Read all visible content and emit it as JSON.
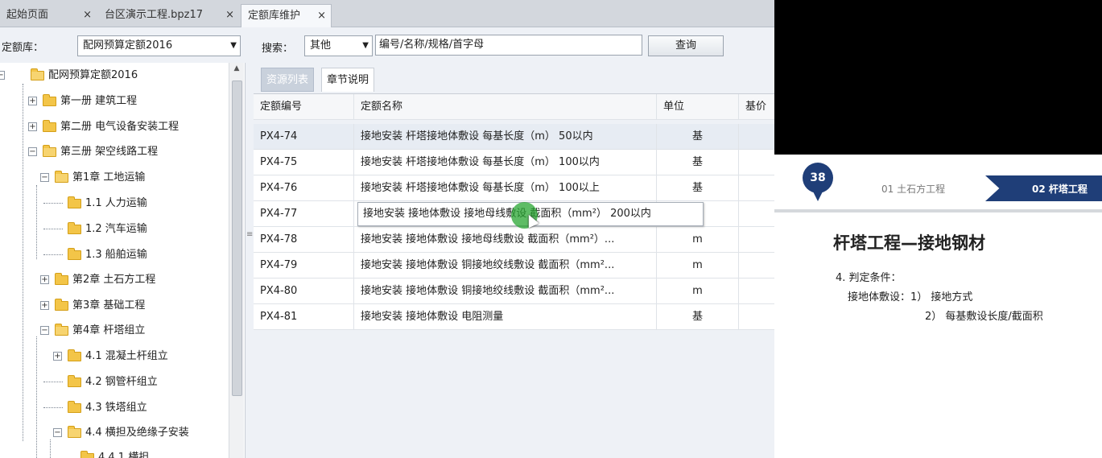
{
  "doc_tabs": [
    {
      "label": "起始页面",
      "close": "×"
    },
    {
      "label": "台区演示工程.bpz17",
      "close": "×"
    },
    {
      "label": "定额库维护",
      "close": "×"
    }
  ],
  "toolbar": {
    "library_label": "定额库：",
    "library_value": "配网预算定额2016",
    "search_label": "搜索：",
    "search_type": "其他",
    "search_placeholder": "编号/名称/规格/首字母",
    "query_button": "查询"
  },
  "tree": {
    "root": "配网预算定额2016",
    "nodes": [
      {
        "label": "第一册 建筑工程"
      },
      {
        "label": "第二册 电气设备安装工程"
      },
      {
        "label": "第三册 架空线路工程"
      },
      {
        "label": "第1章 工地运输"
      },
      {
        "label": "1.1 人力运输"
      },
      {
        "label": "1.2 汽车运输"
      },
      {
        "label": "1.3 船舶运输"
      },
      {
        "label": "第2章 土石方工程"
      },
      {
        "label": "第3章 基础工程"
      },
      {
        "label": "第4章 杆塔组立"
      },
      {
        "label": "4.1 混凝土杆组立"
      },
      {
        "label": "4.2 钢管杆组立"
      },
      {
        "label": "4.3 铁塔组立"
      },
      {
        "label": "4.4 横担及绝缘子安装"
      },
      {
        "label": "4.4.1 横担"
      }
    ]
  },
  "sub_tabs": [
    {
      "label": "资源列表"
    },
    {
      "label": "章节说明"
    }
  ],
  "grid": {
    "headers": {
      "code": "定额编号",
      "name": "定额名称",
      "unit": "单位",
      "price": "基价"
    },
    "rows": [
      {
        "code": "PX4-74",
        "name": "接地安装 杆塔接地体敷设 每基长度（m） 50以内",
        "unit": "基"
      },
      {
        "code": "PX4-75",
        "name": "接地安装 杆塔接地体敷设 每基长度（m） 100以内",
        "unit": "基"
      },
      {
        "code": "PX4-76",
        "name": "接地安装 杆塔接地体敷设 每基长度（m） 100以上",
        "unit": "基"
      },
      {
        "code": "PX4-77",
        "name": "",
        "unit": ""
      },
      {
        "code": "PX4-78",
        "name": "接地安装 接地体敷设 接地母线敷设 截面积（mm²）...",
        "unit": "m"
      },
      {
        "code": "PX4-79",
        "name": "接地安装 接地体敷设 铜接地绞线敷设 截面积（mm²...",
        "unit": "m"
      },
      {
        "code": "PX4-80",
        "name": "接地安装 接地体敷设 铜接地绞线敷设 截面积（mm²...",
        "unit": "m"
      },
      {
        "code": "PX4-81",
        "name": "接地安装 接地体敷设 电阻测量",
        "unit": "基"
      }
    ],
    "tooltip": "接地安装 接地体敷设 接地母线敷设 截面积（mm²） 200以内"
  },
  "slide": {
    "page_number": "38",
    "crumb_inactive": "01 土石方工程",
    "crumb_active": "02 杆塔工程",
    "title": "杆塔工程—接地钢材",
    "line1": "4. 判定条件：",
    "line2": "接地体敷设：1） 接地方式",
    "line3": "2） 每基敷设长度/截面积",
    "accent_color": "#1f3e78"
  }
}
